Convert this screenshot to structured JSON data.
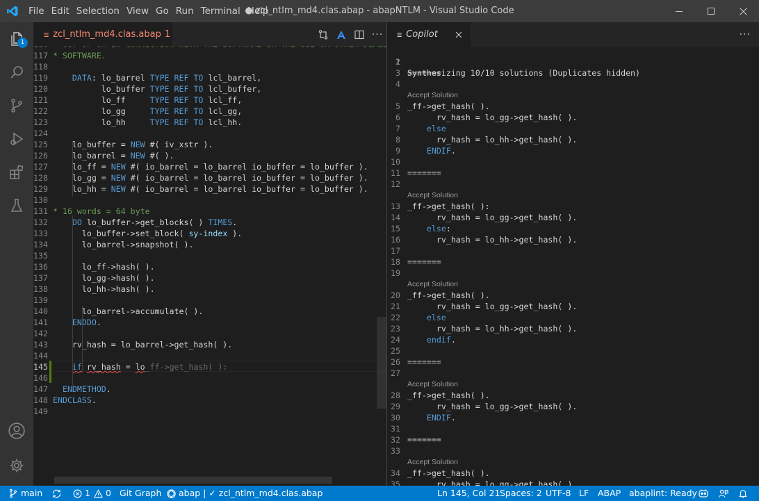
{
  "titlebar": {
    "menu": [
      "File",
      "Edit",
      "Selection",
      "View",
      "Go",
      "Run",
      "Terminal",
      "Help"
    ],
    "title": "● zcl_ntlm_md4.clas.abap - abapNTLM - Visual Studio Code"
  },
  "activitybar": {
    "items": [
      "explorer-icon",
      "search-icon",
      "source-control-icon",
      "run-debug-icon",
      "extensions-icon",
      "testing-icon",
      "account-icon",
      "settings-gear-icon"
    ],
    "explorer_badge": "1"
  },
  "left_tab": {
    "filename": "zcl_ntlm_md4.clas.abap",
    "problems": "1"
  },
  "right_tab": {
    "title": "Copilot"
  },
  "colors": {
    "accent": "#007acc",
    "error": "#f48771",
    "keyword": "#569cd6",
    "comment": "#6a9955"
  },
  "left_lines": [
    {
      "n": "116",
      "t": "* OUT OF OR IN CONNECTION WITH THE SOFTWARE OR THE USE OR OTHER DEALINGS"
    },
    {
      "n": "117",
      "t": "* SOFTWARE."
    },
    {
      "n": "118",
      "t": ""
    },
    {
      "n": "119",
      "t": "    DATA: lo_barrel TYPE REF TO lcl_barrel,"
    },
    {
      "n": "120",
      "t": "          lo_buffer TYPE REF TO lcl_buffer,"
    },
    {
      "n": "121",
      "t": "          lo_ff     TYPE REF TO lcl_ff,"
    },
    {
      "n": "122",
      "t": "          lo_gg     TYPE REF TO lcl_gg,"
    },
    {
      "n": "123",
      "t": "          lo_hh     TYPE REF TO lcl_hh."
    },
    {
      "n": "124",
      "t": ""
    },
    {
      "n": "125",
      "t": "    lo_buffer = NEW #( iv_xstr )."
    },
    {
      "n": "126",
      "t": "    lo_barrel = NEW #( )."
    },
    {
      "n": "127",
      "t": "    lo_ff = NEW #( io_barrel = lo_barrel io_buffer = lo_buffer )."
    },
    {
      "n": "128",
      "t": "    lo_gg = NEW #( io_barrel = lo_barrel io_buffer = lo_buffer )."
    },
    {
      "n": "129",
      "t": "    lo_hh = NEW #( io_barrel = lo_barrel io_buffer = lo_buffer )."
    },
    {
      "n": "130",
      "t": ""
    },
    {
      "n": "131",
      "t": "* 16 words = 64 byte"
    },
    {
      "n": "132",
      "t": "    DO lo_buffer->get_blocks( ) TIMES."
    },
    {
      "n": "133",
      "t": "      lo_buffer->set_block( sy-index )."
    },
    {
      "n": "134",
      "t": "      lo_barrel->snapshot( )."
    },
    {
      "n": "135",
      "t": ""
    },
    {
      "n": "136",
      "t": "      lo_ff->hash( )."
    },
    {
      "n": "137",
      "t": "      lo_gg->hash( )."
    },
    {
      "n": "138",
      "t": "      lo_hh->hash( )."
    },
    {
      "n": "139",
      "t": ""
    },
    {
      "n": "140",
      "t": "      lo_barrel->accumulate( )."
    },
    {
      "n": "141",
      "t": "    ENDDO."
    },
    {
      "n": "142",
      "t": ""
    },
    {
      "n": "143",
      "t": "    rv_hash = lo_barrel->get_hash( )."
    },
    {
      "n": "144",
      "t": ""
    },
    {
      "n": "145",
      "t": "    if rv_hash = lo"
    },
    {
      "n": "146",
      "t": ""
    },
    {
      "n": "147",
      "t": "  ENDMETHOD."
    },
    {
      "n": "148",
      "t": "ENDCLASS."
    },
    {
      "n": "149",
      "t": ""
    }
  ],
  "ghost_text": "_ff->get_hash( ):",
  "right_header": {
    "n": "1",
    "t": "Synthesizing 10/10 solutions (Duplicates hidden)"
  },
  "accept_label": "Accept Solution",
  "separator": "=======",
  "right_lines": [
    {
      "n": "2",
      "t": ""
    },
    {
      "n": "3",
      "t": "======="
    },
    {
      "n": "4",
      "t": ""
    },
    {
      "n": "5",
      "t": "_ff->get_hash( ).",
      "lens": true
    },
    {
      "n": "6",
      "t": "      rv_hash = lo_gg->get_hash( )."
    },
    {
      "n": "7",
      "t": "    else"
    },
    {
      "n": "8",
      "t": "      rv_hash = lo_hh->get_hash( )."
    },
    {
      "n": "9",
      "t": "    ENDIF."
    },
    {
      "n": "10",
      "t": ""
    },
    {
      "n": "11",
      "t": "======="
    },
    {
      "n": "12",
      "t": ""
    },
    {
      "n": "13",
      "t": "_ff->get_hash( ):",
      "lens": true
    },
    {
      "n": "14",
      "t": "      rv_hash = lo_gg->get_hash( )."
    },
    {
      "n": "15",
      "t": "    else:"
    },
    {
      "n": "16",
      "t": "      rv_hash = lo_hh->get_hash( )."
    },
    {
      "n": "17",
      "t": ""
    },
    {
      "n": "18",
      "t": "======="
    },
    {
      "n": "19",
      "t": ""
    },
    {
      "n": "20",
      "t": "_ff->get_hash( ).",
      "lens": true
    },
    {
      "n": "21",
      "t": "      rv_hash = lo_gg->get_hash( )."
    },
    {
      "n": "22",
      "t": "    else"
    },
    {
      "n": "23",
      "t": "      rv_hash = lo_hh->get_hash( )."
    },
    {
      "n": "24",
      "t": "    endif."
    },
    {
      "n": "25",
      "t": ""
    },
    {
      "n": "26",
      "t": "======="
    },
    {
      "n": "27",
      "t": ""
    },
    {
      "n": "28",
      "t": "_ff->get_hash( ).",
      "lens": true
    },
    {
      "n": "29",
      "t": "      rv_hash = lo_gg->get_hash( )."
    },
    {
      "n": "30",
      "t": "    ENDIF."
    },
    {
      "n": "31",
      "t": ""
    },
    {
      "n": "32",
      "t": "======="
    },
    {
      "n": "33",
      "t": ""
    },
    {
      "n": "34",
      "t": "_ff->get_hash( ).",
      "lens": true
    },
    {
      "n": "35",
      "t": "      rv_hash = lo_gg->get_hash( )."
    }
  ],
  "statusbar": {
    "branch": "main",
    "errors": "1",
    "warnings": "0",
    "git_graph": "Git Graph",
    "context": "abap | ✓ zcl_ntlm_md4.clas.abap",
    "position": "Ln 145, Col 21",
    "spaces": "Spaces: 2",
    "encoding": "UTF-8",
    "eol": "LF",
    "language": "ABAP",
    "linter": "abaplint: Ready"
  }
}
